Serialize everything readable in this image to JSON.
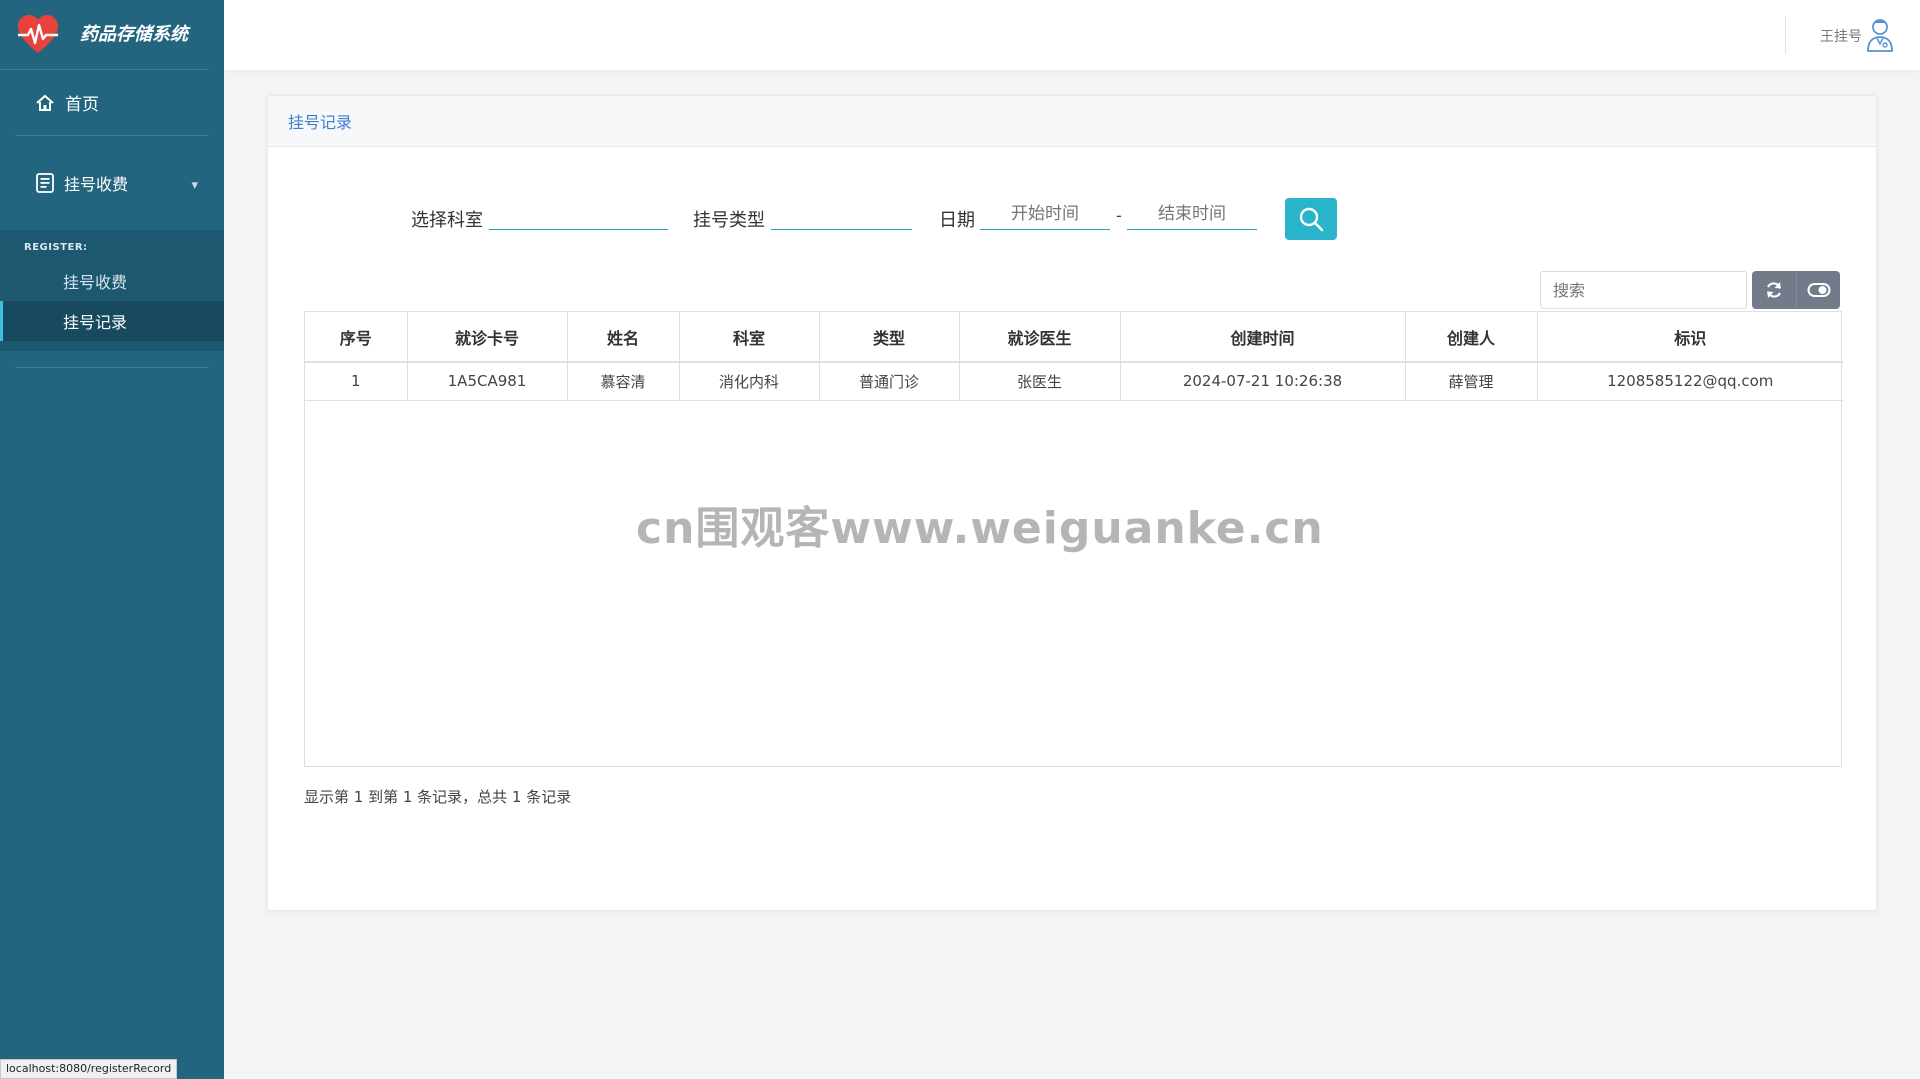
{
  "app": {
    "title": "药品存储系统"
  },
  "sidebar": {
    "home_label": "首页",
    "group_label": "挂号收费",
    "submenu_header": "REGISTER:",
    "items": [
      {
        "label": "挂号收费",
        "active": false
      },
      {
        "label": "挂号记录",
        "active": true
      }
    ]
  },
  "header": {
    "user_name": "王挂号"
  },
  "card": {
    "title": "挂号记录"
  },
  "filters": {
    "department_label": "选择科室",
    "type_label": "挂号类型",
    "date_label": "日期",
    "start_placeholder": "开始时间",
    "date_separator": "-",
    "end_placeholder": "结束时间"
  },
  "toolbar": {
    "search_placeholder": "搜索"
  },
  "table": {
    "columns": [
      "序号",
      "就诊卡号",
      "姓名",
      "科室",
      "类型",
      "就诊医生",
      "创建时间",
      "创建人",
      "标识"
    ],
    "rows": [
      [
        "1",
        "1A5CA981",
        "慕容清",
        "消化内科",
        "普通门诊",
        "张医生",
        "2024-07-21 10:26:38",
        "薛管理",
        "1208585122@qq.com"
      ]
    ]
  },
  "pager": {
    "info": "显示第 1 到第 1 条记录，总共 1 条记录"
  },
  "watermark": "cn围观客www.weiguanke.cn",
  "status_bar": {
    "url": "localhost:8080/registerRecord"
  },
  "colors": {
    "sidebar": "#23657f",
    "accent": "#2ab4cb",
    "link": "#3f7fd0"
  }
}
